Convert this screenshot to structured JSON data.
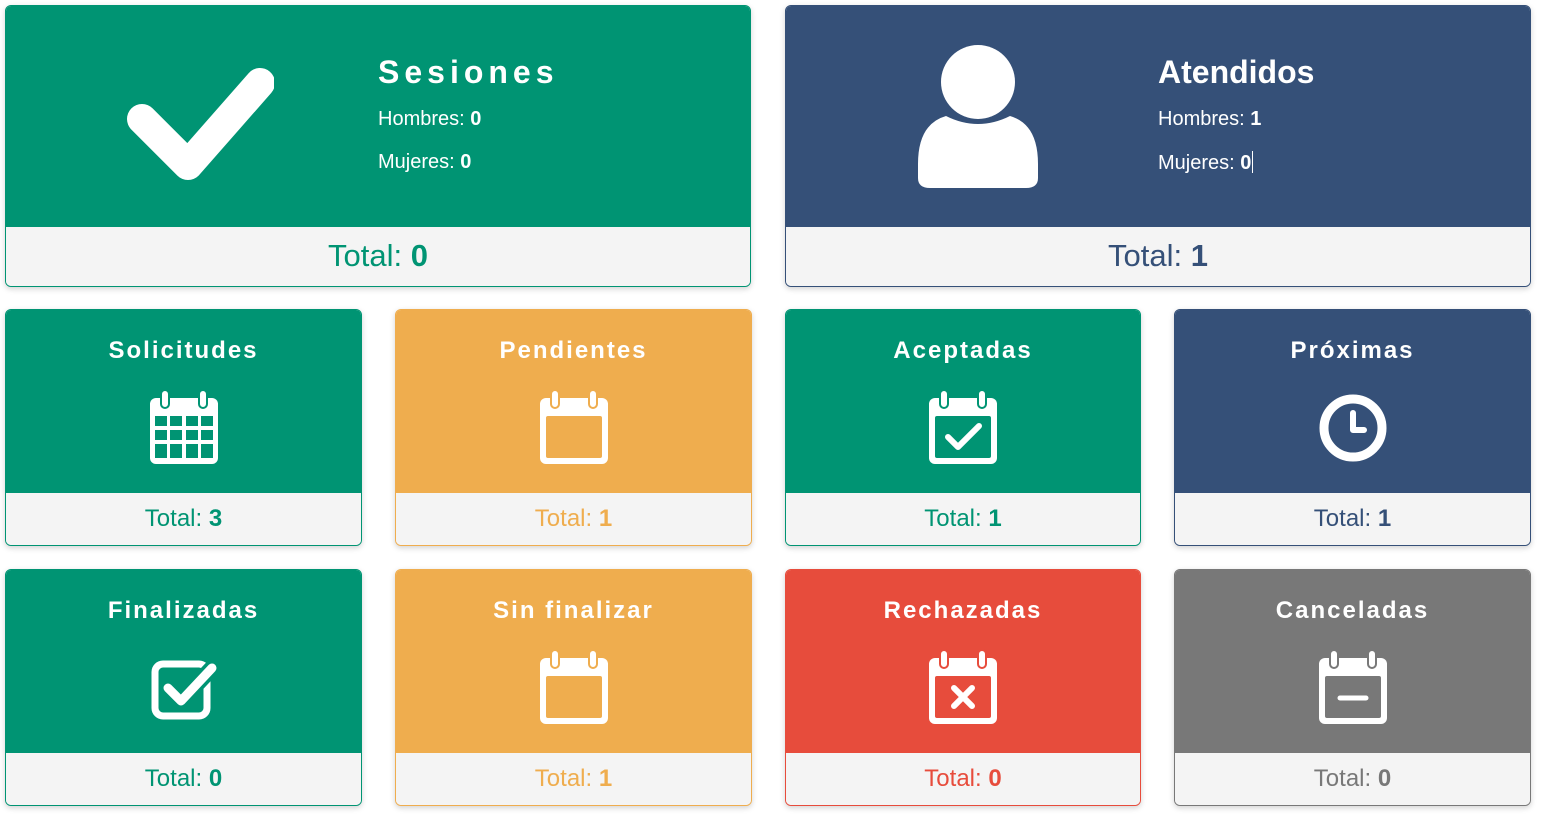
{
  "colors": {
    "green": "#009473",
    "navy": "#355078",
    "orange": "#efad4e",
    "red": "#e74c3c",
    "gray": "#787878",
    "footer_bg": "#f4f4f4"
  },
  "big_cards": {
    "sesiones": {
      "title": "Sesiones",
      "hombres_label": "Hombres: ",
      "hombres_value": "0",
      "mujeres_label": "Mujeres: ",
      "mujeres_value": "0",
      "total_label": "Total: ",
      "total_value": "0",
      "icon": "check-icon"
    },
    "atendidos": {
      "title": "Atendidos",
      "hombres_label": "Hombres: ",
      "hombres_value": "1",
      "mujeres_label": "Mujeres: ",
      "mujeres_value": "0",
      "total_label": "Total: ",
      "total_value": "1",
      "icon": "user-icon"
    }
  },
  "small_cards": {
    "solicitudes": {
      "title": "Solicitudes",
      "total_label": "Total: ",
      "total_value": "3",
      "icon": "calendar-grid-icon"
    },
    "pendientes": {
      "title": "Pendientes",
      "total_label": "Total: ",
      "total_value": "1",
      "icon": "calendar-empty-icon"
    },
    "aceptadas": {
      "title": "Aceptadas",
      "total_label": "Total: ",
      "total_value": "1",
      "icon": "calendar-check-icon"
    },
    "proximas": {
      "title": "Próximas",
      "total_label": "Total: ",
      "total_value": "1",
      "icon": "clock-icon"
    },
    "finalizadas": {
      "title": "Finalizadas",
      "total_label": "Total: ",
      "total_value": "0",
      "icon": "checkbox-icon"
    },
    "sin_finalizar": {
      "title": "Sin finalizar",
      "total_label": "Total: ",
      "total_value": "1",
      "icon": "calendar-empty-icon"
    },
    "rechazadas": {
      "title": "Rechazadas",
      "total_label": "Total: ",
      "total_value": "0",
      "icon": "calendar-times-icon"
    },
    "canceladas": {
      "title": "Canceladas",
      "total_label": "Total: ",
      "total_value": "0",
      "icon": "calendar-minus-icon"
    }
  }
}
